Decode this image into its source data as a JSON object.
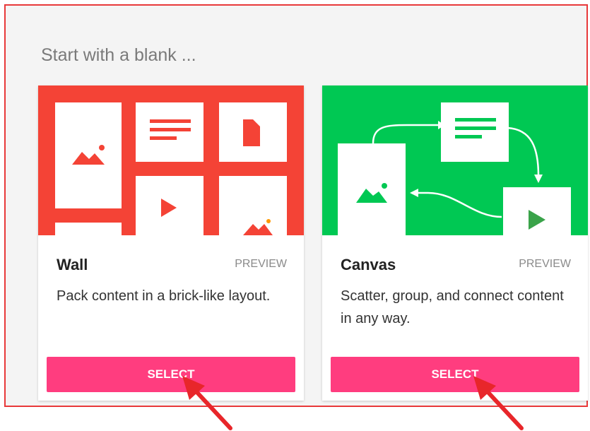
{
  "heading": "Start with a blank ...",
  "cards": [
    {
      "title": "Wall",
      "preview_label": "PREVIEW",
      "description": "Pack content in a brick-like layout.",
      "button_label": "SELECT",
      "accent_color": "#f44336"
    },
    {
      "title": "Canvas",
      "preview_label": "PREVIEW",
      "description": "Scatter, group, and connect content in any way.",
      "button_label": "SELECT",
      "accent_color": "#00c853"
    }
  ],
  "annotation": {
    "arrow_color": "#e8262a",
    "icons": [
      "red-arrow-icon",
      "red-arrow-icon"
    ]
  }
}
